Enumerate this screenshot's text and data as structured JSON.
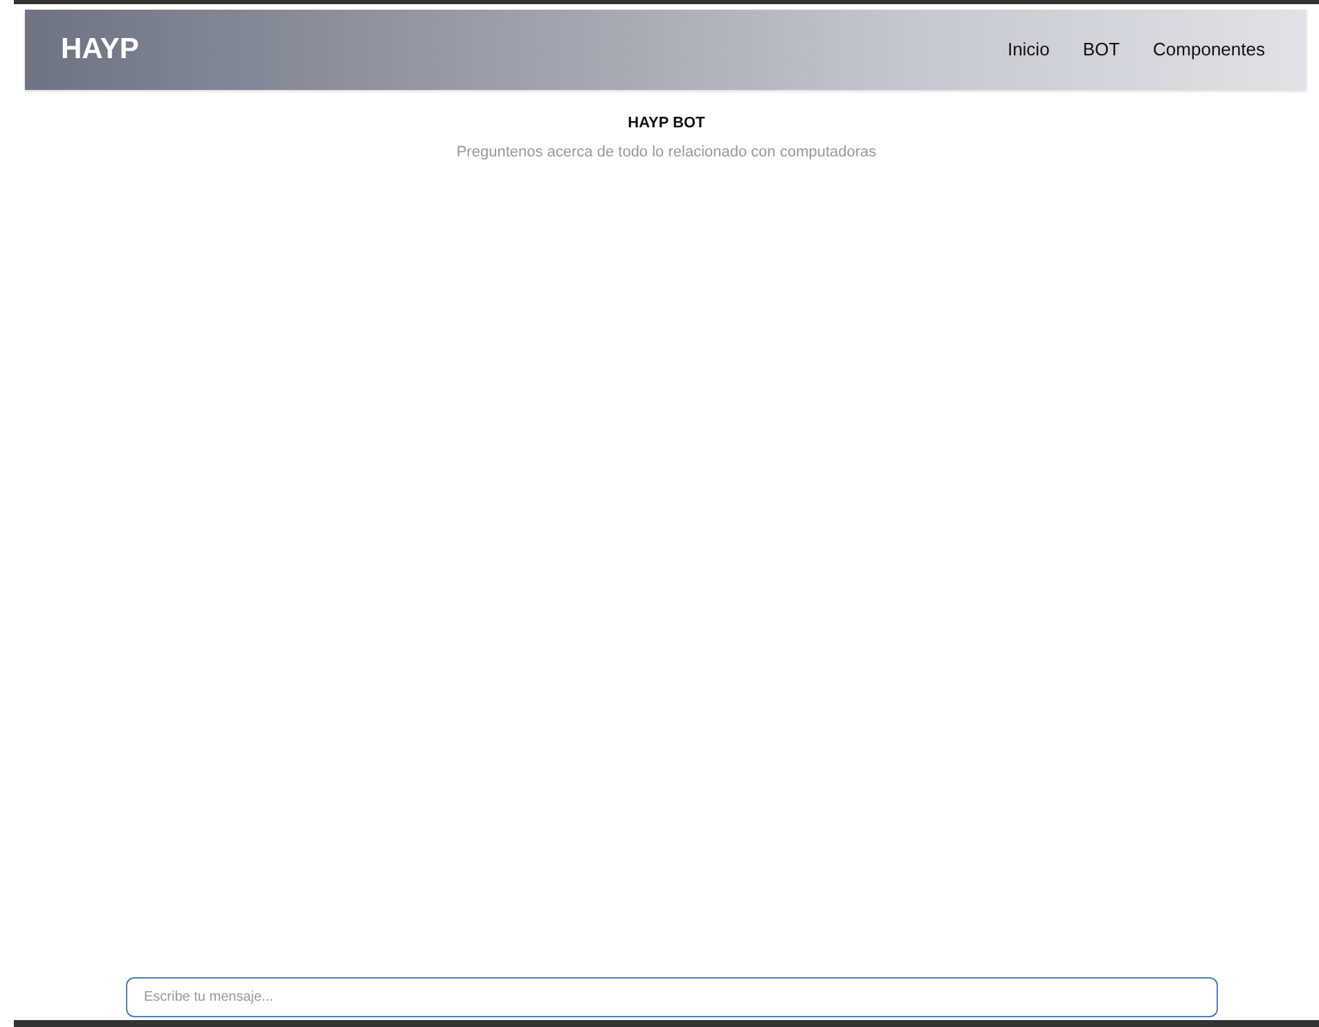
{
  "navbar": {
    "brand": "HAYP",
    "links": [
      {
        "label": "Inicio"
      },
      {
        "label": "BOT"
      },
      {
        "label": "Componentes"
      }
    ]
  },
  "header": {
    "title": "HAYP BOT",
    "subtitle": "Preguntenos acerca de todo lo relacionado con computadoras"
  },
  "chat_input": {
    "placeholder": "Escribe tu mensaje..."
  }
}
